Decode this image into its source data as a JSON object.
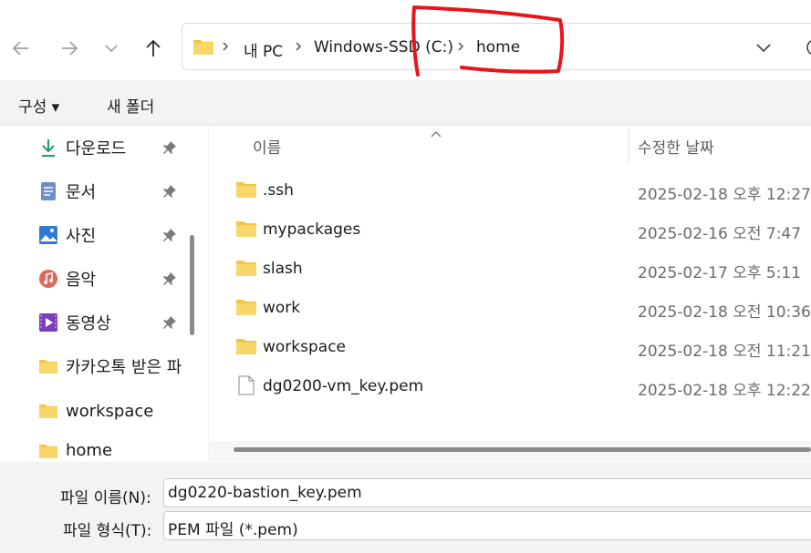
{
  "nav": {
    "back_icon": "arrow-left-icon",
    "forward_icon": "arrow-right-icon",
    "recent_icon": "chevron-down-icon",
    "up_icon": "arrow-up-icon"
  },
  "address": {
    "folder_icon": "folder-icon",
    "crumbs": [
      "내 PC",
      "Windows-SSD (C:)",
      "home"
    ],
    "dropdown_icon": "chevron-down-icon",
    "refresh_icon": "refresh-icon"
  },
  "commands": {
    "organize": "구성 ▾",
    "new_folder": "새 폴더"
  },
  "sidebar": {
    "items": [
      {
        "label": "다운로드",
        "icon": "download-icon",
        "pinned": true
      },
      {
        "label": "문서",
        "icon": "document-icon",
        "pinned": true
      },
      {
        "label": "사진",
        "icon": "pictures-icon",
        "pinned": true
      },
      {
        "label": "음악",
        "icon": "music-icon",
        "pinned": true
      },
      {
        "label": "동영상",
        "icon": "video-icon",
        "pinned": true
      },
      {
        "label": "카카오톡 받은 파",
        "icon": "folder-icon",
        "pinned": false
      },
      {
        "label": "workspace",
        "icon": "folder-icon",
        "pinned": false
      },
      {
        "label": "home",
        "icon": "folder-icon",
        "pinned": false
      }
    ]
  },
  "filelist": {
    "columns": {
      "name": "이름",
      "modified": "수정한 날짜"
    },
    "rows": [
      {
        "name": ".ssh",
        "date": "2025-02-18 오후 12:27",
        "type": "folder"
      },
      {
        "name": "mypackages",
        "date": "2025-02-16 오전 7:47",
        "type": "folder"
      },
      {
        "name": "slash",
        "date": "2025-02-17 오후 5:11",
        "type": "folder"
      },
      {
        "name": "work",
        "date": "2025-02-18 오전 10:36",
        "type": "folder"
      },
      {
        "name": "workspace",
        "date": "2025-02-18 오전 11:21",
        "type": "folder"
      },
      {
        "name": "dg0200-vm_key.pem",
        "date": "2025-02-18 오후 12:22",
        "type": "file"
      }
    ]
  },
  "bottom": {
    "filename_label": "파일 이름(N):",
    "filename_value": "dg0220-bastion_key.pem",
    "filetype_label": "파일 형식(T):",
    "filetype_value": "PEM 파일 (*.pem)"
  },
  "colors": {
    "annotation": "#e8141c",
    "folder": "#f4c542"
  }
}
